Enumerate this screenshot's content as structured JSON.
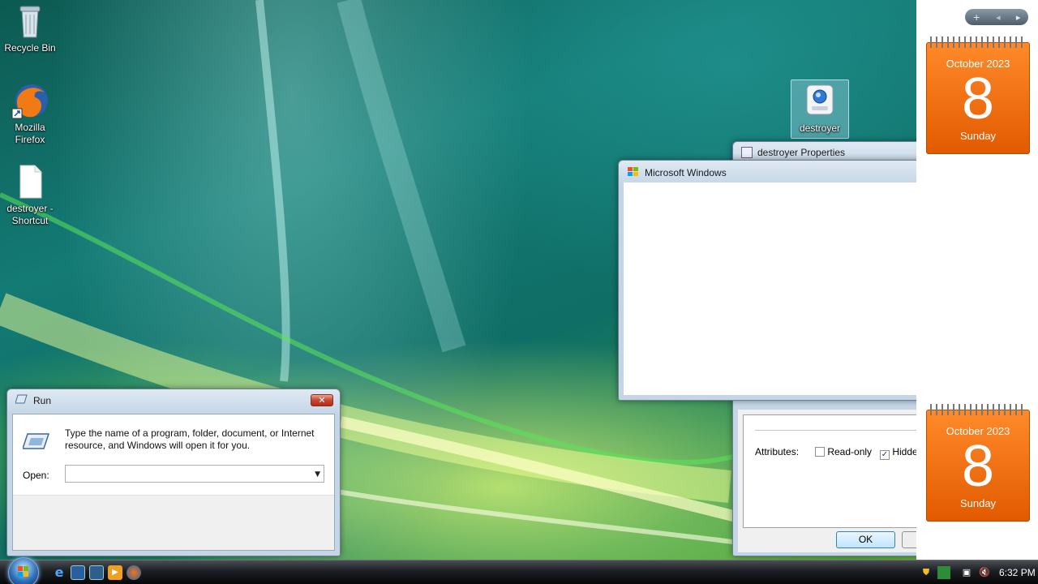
{
  "desktop": {
    "icons": [
      {
        "label": "Recycle Bin",
        "icon": "recycle-bin-icon"
      },
      {
        "label": "Mozilla Firefox",
        "icon": "firefox-icon"
      },
      {
        "label": "destroyer - Shortcut",
        "icon": "file-shortcut-icon"
      },
      {
        "label": "destroyer",
        "icon": "exe-icon"
      }
    ]
  },
  "sidebar": {
    "toolbar": {
      "add": "+",
      "prev": "◂",
      "next": "▸"
    },
    "calendars": [
      {
        "month": "October 2023",
        "day": "8",
        "weekday": "Sunday"
      },
      {
        "month": "October 2023",
        "day": "8",
        "weekday": "Sunday"
      }
    ]
  },
  "properties_window": {
    "title": "destroyer Properties",
    "attributes_label": "Attributes:",
    "readonly_label": "Read-only",
    "readonly_checked": false,
    "hidden_label": "Hidden",
    "hidden_checked": true,
    "ok_label": "OK"
  },
  "message_window": {
    "title": "Microsoft Windows",
    "close": "✕"
  },
  "run_dialog": {
    "title": "Run",
    "description": "Type the name of a program, folder, document, or Internet resource, and Windows will open it for you.",
    "open_label": "Open:",
    "open_value": "",
    "close": "✕"
  },
  "taskbar": {
    "quick_launch": [
      "internet-explorer-icon",
      "show-desktop-icon",
      "switch-windows-icon",
      "media-player-icon",
      "firefox-icon"
    ],
    "tray_icons": [
      "security-shield-icon",
      "windows-update-icon",
      "network-icon",
      "volume-muted-icon"
    ],
    "clock": "6:32 PM"
  },
  "colors": {
    "calendar": "#f26d0f",
    "close_button": "#c74531",
    "taskbar": "#1c1f23"
  }
}
